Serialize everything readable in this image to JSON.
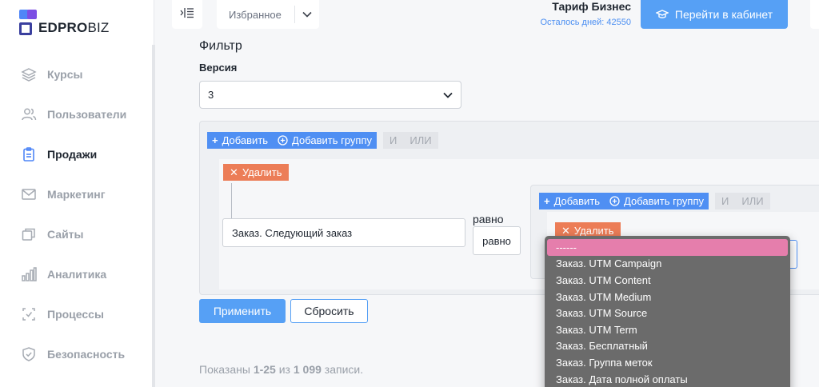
{
  "brand": {
    "name_bold": "EDPRO",
    "name_light": "BIZ",
    "colors": {
      "blue": "#4f86f7",
      "purple": "#7c4ee4",
      "navy": "#3a3f9e"
    }
  },
  "sidebar": {
    "items": [
      {
        "label": "Курсы",
        "icon": "layers-icon",
        "active": false
      },
      {
        "label": "Пользователи",
        "icon": "users-icon",
        "active": false
      },
      {
        "label": "Продажи",
        "icon": "clipboard-icon",
        "active": true
      },
      {
        "label": "Маркетинг",
        "icon": "mail-icon",
        "active": false
      },
      {
        "label": "Сайты",
        "icon": "windows-icon",
        "active": false
      },
      {
        "label": "Аналитика",
        "icon": "bar-chart-icon",
        "active": false
      },
      {
        "label": "Процессы",
        "icon": "process-icon",
        "active": false
      },
      {
        "label": "Безопасность",
        "icon": "shield-icon",
        "active": false
      }
    ]
  },
  "topbar": {
    "favorites_label": "Избранное",
    "plan_title": "Тариф Бизнес",
    "plan_days": "Осталось дней: 42550",
    "cabinet_button": "Перейти в кабинет"
  },
  "filter": {
    "title": "Фильтр",
    "version_label": "Версия",
    "version_value": "3",
    "outer_group": {
      "add_label": "Добавить",
      "add_group_label": "Добавить группу",
      "and_label": "И",
      "or_label": "ИЛИ",
      "delete_label": "Удалить",
      "field_value": "Заказ. Следующий заказ",
      "operator_label": "равно",
      "operator_value": "равно"
    },
    "inner_group": {
      "add_label": "Добавить",
      "add_group_label": "Добавить группу",
      "and_label": "И",
      "or_label": "ИЛИ",
      "delete_label": "Удалить"
    },
    "apply_button": "Применить",
    "reset_button": "Сбросить"
  },
  "results": {
    "prefix": "Показаны ",
    "range": "1-25",
    "middle": " из ",
    "total": "1 099",
    "suffix": " записи."
  },
  "dropdown": {
    "options": [
      "------",
      "Заказ. UTM Campaign",
      "Заказ. UTM Content",
      "Заказ. UTM Medium",
      "Заказ. UTM Source",
      "Заказ. UTM Term",
      "Заказ. Бесплатный",
      "Заказ. Группа меток",
      "Заказ. Дата полной оплаты"
    ],
    "selected_index": 0,
    "highlight_color": "#e57eac"
  }
}
